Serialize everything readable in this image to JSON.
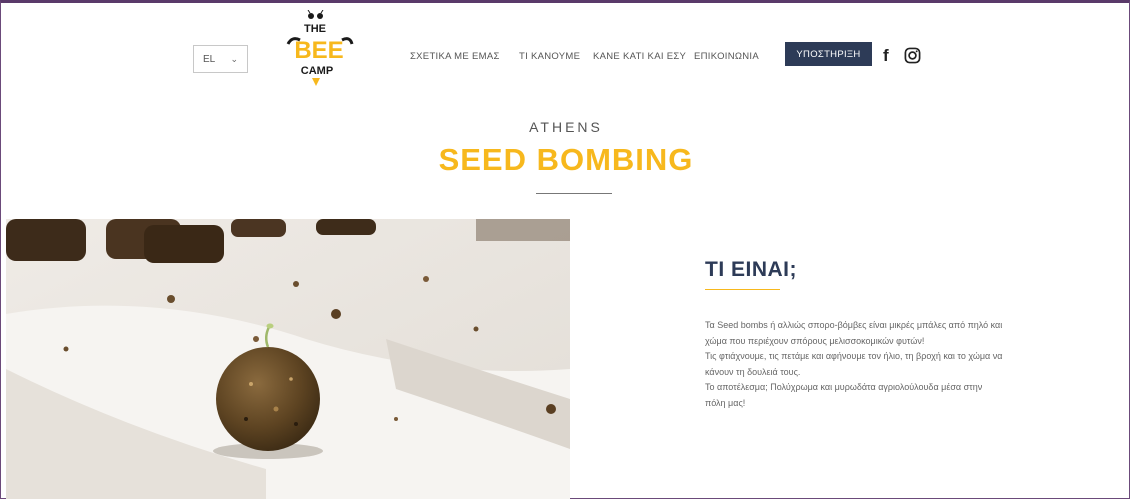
{
  "header": {
    "language": "EL",
    "logo_text": {
      "line1": "THE",
      "line2": "BEE",
      "line3": "CAMP"
    },
    "nav": [
      {
        "label": "ΣΧΕΤΙΚΑ ΜΕ ΕΜΑΣ"
      },
      {
        "label": "ΤΙ ΚΑΝΟΥΜΕ"
      },
      {
        "label": "ΚΑΝΕ ΚΑΤΙ ΚΑΙ ΕΣΥ"
      },
      {
        "label": "ΕΠΙΚΟΙΝΩΝΙΑ"
      }
    ],
    "support_label": "ΥΠΟΣΤΗΡΙΞΗ",
    "facebook_glyph": "f"
  },
  "hero": {
    "kicker": "ATHENS",
    "title": "SEED BOMBING"
  },
  "section": {
    "title": "ΤΙ ΕΙΝΑΙ;",
    "paragraphs": [
      "Τα Seed bombs ή αλλιώς σπορο-βόμβες είναι μικρές μπάλες από πηλό και χώμα που περιέχουν σπόρους μελισσοκομικών φυτών!",
      "Τις φτιάχνουμε, τις πετάμε και αφήνουμε τον ήλιο, τη βροχή και το χώμα να κάνουν τη δουλειά τους.",
      "Το αποτέλεσμα; Πολύχρωμα και μυρωδάτα αγριολούλουδα μέσα στην πόλη μας!"
    ]
  },
  "colors": {
    "accent": "#f7b81d",
    "navy": "#2d3b57",
    "text": "#666666"
  },
  "icons": [
    "chevron-down-icon",
    "facebook-icon",
    "instagram-icon"
  ]
}
